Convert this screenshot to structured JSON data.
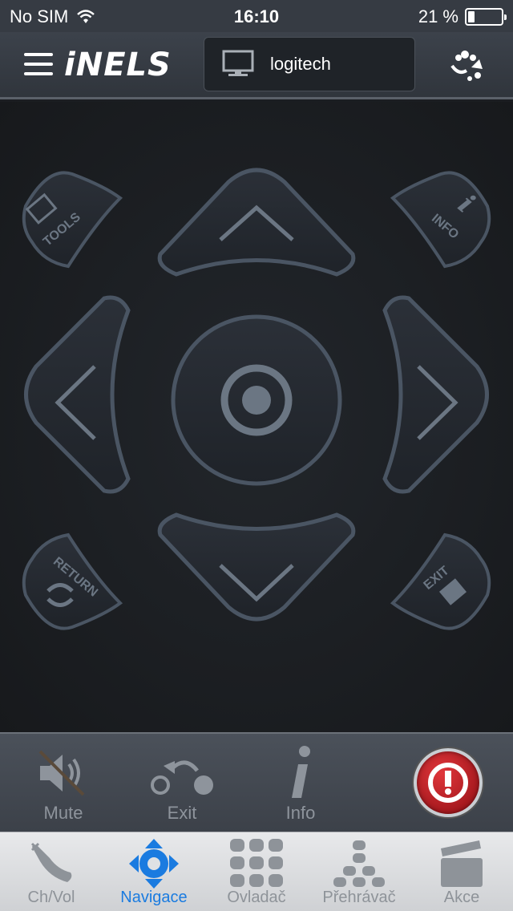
{
  "status_bar": {
    "carrier": "No SIM",
    "time": "16:10",
    "battery_percent": "21 %",
    "battery_level": 0.21
  },
  "header": {
    "logo": "iNELS",
    "device": "logitech"
  },
  "remote": {
    "tools_label": "TOOLS",
    "info_label": "INFO",
    "return_label": "RETURN",
    "exit_label": "EXIT"
  },
  "controls": {
    "mute_label": "Mute",
    "exit_label": "Exit",
    "info_label": "Info"
  },
  "tabs": [
    {
      "label": "Ch/Vol",
      "active": false
    },
    {
      "label": "Navigace",
      "active": true
    },
    {
      "label": "Ovladač",
      "active": false
    },
    {
      "label": "Přehrávač",
      "active": false
    },
    {
      "label": "Akce",
      "active": false
    }
  ],
  "colors": {
    "accent": "#1a7be0",
    "power": "#c8151c",
    "pad_stroke": "#4a5563"
  }
}
